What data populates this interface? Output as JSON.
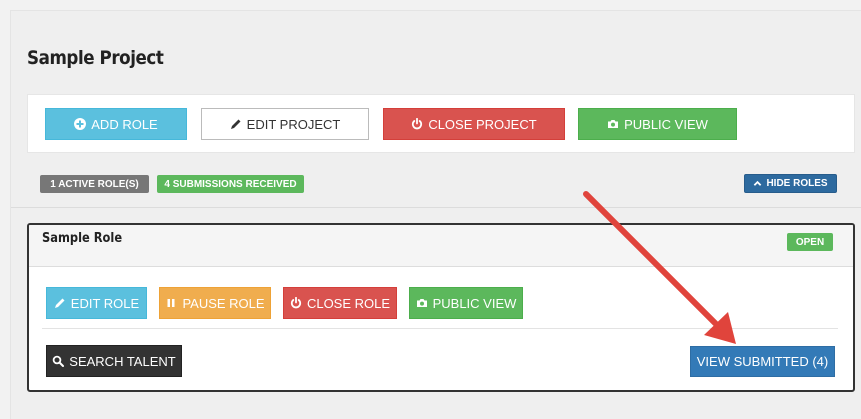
{
  "project": {
    "title": "Sample Project",
    "actions": {
      "add_role": "ADD ROLE",
      "edit_project": "EDIT PROJECT",
      "close_project": "CLOSE PROJECT",
      "public_view": "PUBLIC VIEW"
    },
    "badges": {
      "active_roles": "1 ACTIVE ROLE(S)",
      "submissions": "4 SUBMISSIONS RECEIVED"
    },
    "hide_roles": "HIDE ROLES"
  },
  "role": {
    "title": "Sample Role",
    "status": "OPEN",
    "actions": {
      "edit_role": "EDIT ROLE",
      "pause_role": "PAUSE ROLE",
      "close_role": "CLOSE ROLE",
      "public_view": "PUBLIC VIEW",
      "search_talent": "SEARCH TALENT",
      "view_submitted": "VIEW SUBMITTED (4)"
    }
  },
  "annotation": {
    "arrow_color": "#e0443c"
  },
  "icons": {
    "add": "plus-circle-icon",
    "edit": "pencil-icon",
    "close": "power-icon",
    "public": "camera-icon",
    "hide": "chevron-up-icon",
    "pause": "pause-icon",
    "search": "search-icon"
  }
}
